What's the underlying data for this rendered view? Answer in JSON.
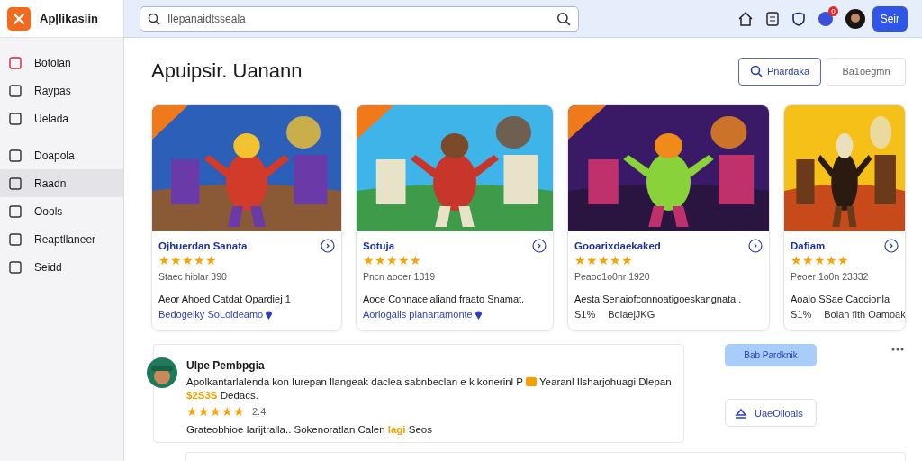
{
  "app": {
    "name": "Apļlikasiin"
  },
  "search": {
    "placeholder": "Ilepanaidtsseala"
  },
  "header": {
    "notification_count": "0",
    "action": "Seir"
  },
  "sidebar": {
    "groups": [
      [
        {
          "label": "Botolan",
          "selected": false
        },
        {
          "label": "Raypas",
          "selected": false
        },
        {
          "label": "Uelada",
          "selected": false
        }
      ],
      [
        {
          "label": "Doapola",
          "selected": false
        },
        {
          "label": "Raadn",
          "selected": true
        },
        {
          "label": "Oools",
          "selected": false
        },
        {
          "label": "Reaptllaneer",
          "selected": false
        },
        {
          "label": "Seidd",
          "selected": false
        }
      ]
    ]
  },
  "page": {
    "title": "Apuipsir. Uanann",
    "buttons": [
      {
        "label": "Pnardaka",
        "kind": "primary"
      },
      {
        "label": "Ba1oegmn",
        "kind": "plain"
      }
    ]
  },
  "cards": [
    {
      "title": "Ojhuerdan Sanata",
      "stars": 5,
      "meta": "Staec hiblar 390",
      "line1": "Aeor Ahoed Catdat Opardiej 1",
      "line2": [
        "Bedogeiky SoLoideamo"
      ],
      "ribbon": true
    },
    {
      "title": "Sotuja",
      "stars": 5,
      "meta": "Pncn aooer 1319",
      "line1": "Aoce Connacelaliand fraato Snamat.",
      "line2": [
        "Aorlogalis planartamonte"
      ],
      "ribbon": true
    },
    {
      "title": "Gooarixdaekaked",
      "stars": 5,
      "meta": "Peaoo1o0nr 1920",
      "line1": "Aesta Senaiofconnoatigoeskangnata .",
      "line2": [
        "S1%",
        "BoiaejJKG"
      ],
      "ribbon": true
    },
    {
      "title": "Dafiam",
      "stars": 5,
      "meta": "Peoer 1o0n 23332",
      "line1": "Aoalo SSae Caocionla",
      "line2": [
        "S1%",
        "Bolan fith Oamoak"
      ],
      "ribbon": false
    }
  ],
  "review": {
    "author": "Ulpe Pembpgia",
    "text": "Apolkantarlalenda kon Iurepan llangeak daclea sabnbeclan e k konerinl P",
    "text_tail": "Yearanl",
    "text_more": "Ilsharjohuagi",
    "text2": "Dlepan",
    "price": "$2S3S",
    "text2_tail": "Dedacs.",
    "stars": 5,
    "score": "2.4",
    "footer": "Grateobhioe Iarijtralla.. Sokenoratlan Calen",
    "footer_highlight": "Iagi",
    "footer_tail": "Seos"
  },
  "side_actions": {
    "tooltip": "Bab Pardknik",
    "button": "UaeOlloais"
  }
}
